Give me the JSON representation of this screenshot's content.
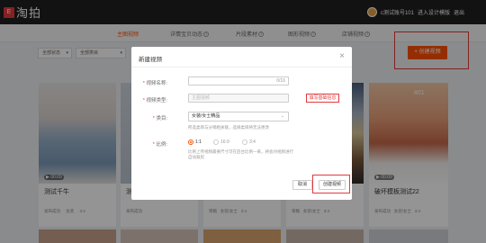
{
  "app": {
    "badge": "E",
    "name": "淘拍"
  },
  "user": {
    "name": "c测试账号101",
    "enter_label": "进入设计模版",
    "logout_label": "退出"
  },
  "nav": {
    "tabs": [
      {
        "label": "主图视频"
      },
      {
        "label": "详情宝贝动态"
      },
      {
        "label": "片段素材"
      },
      {
        "label": "图形视频"
      },
      {
        "label": "店铺视频"
      }
    ]
  },
  "filters": {
    "status": "全部状态",
    "category": "全部类目"
  },
  "toolbar": {
    "create_label": "+ 创建视频"
  },
  "cards": [
    {
      "name": "测试千牛",
      "status": "发布成功",
      "type": "女装",
      "ratio": "3:4",
      "duration": "00:09"
    },
    {
      "name": "测",
      "status": "发布成功",
      "type": "",
      "ratio": "",
      "duration": ""
    },
    {
      "name": "",
      "status": "草稿",
      "type": "女装/女士",
      "ratio": "3:4",
      "duration": ""
    },
    {
      "name": "破坏模板测试22",
      "status": "发布成功",
      "type": "女装/女士",
      "ratio": "3:4",
      "duration": "00:09"
    },
    {
      "name": "",
      "status": "草稿",
      "type": "女装/女士",
      "ratio": "3:4",
      "duration": ""
    }
  ],
  "card_badge": "#01",
  "modal": {
    "title": "新建视频",
    "name_label": "视频名称:",
    "name_count": "0/16",
    "type_label": "视频类型:",
    "type_placeholder": "主图视频",
    "annotation": "填写基础信息",
    "category_label": "类目:",
    "category_value": "女装/女士精品",
    "category_hint": "所选类目与分销相关联，选择类目将无法更改",
    "ratio_label": "比例:",
    "ratios": [
      "1:1",
      "16:9",
      "3:4"
    ],
    "ratio_hint_1": "比例上传视频最要尺寸可在后台比例一来，将会对视频进行",
    "ratio_hint_2": "自动裁剪",
    "cancel_label": "取消",
    "create_label": "创建视频"
  },
  "colors": {
    "accent": "#ff5000",
    "annotation_red": "#e4393c",
    "topbar": "#1f1f1f"
  }
}
